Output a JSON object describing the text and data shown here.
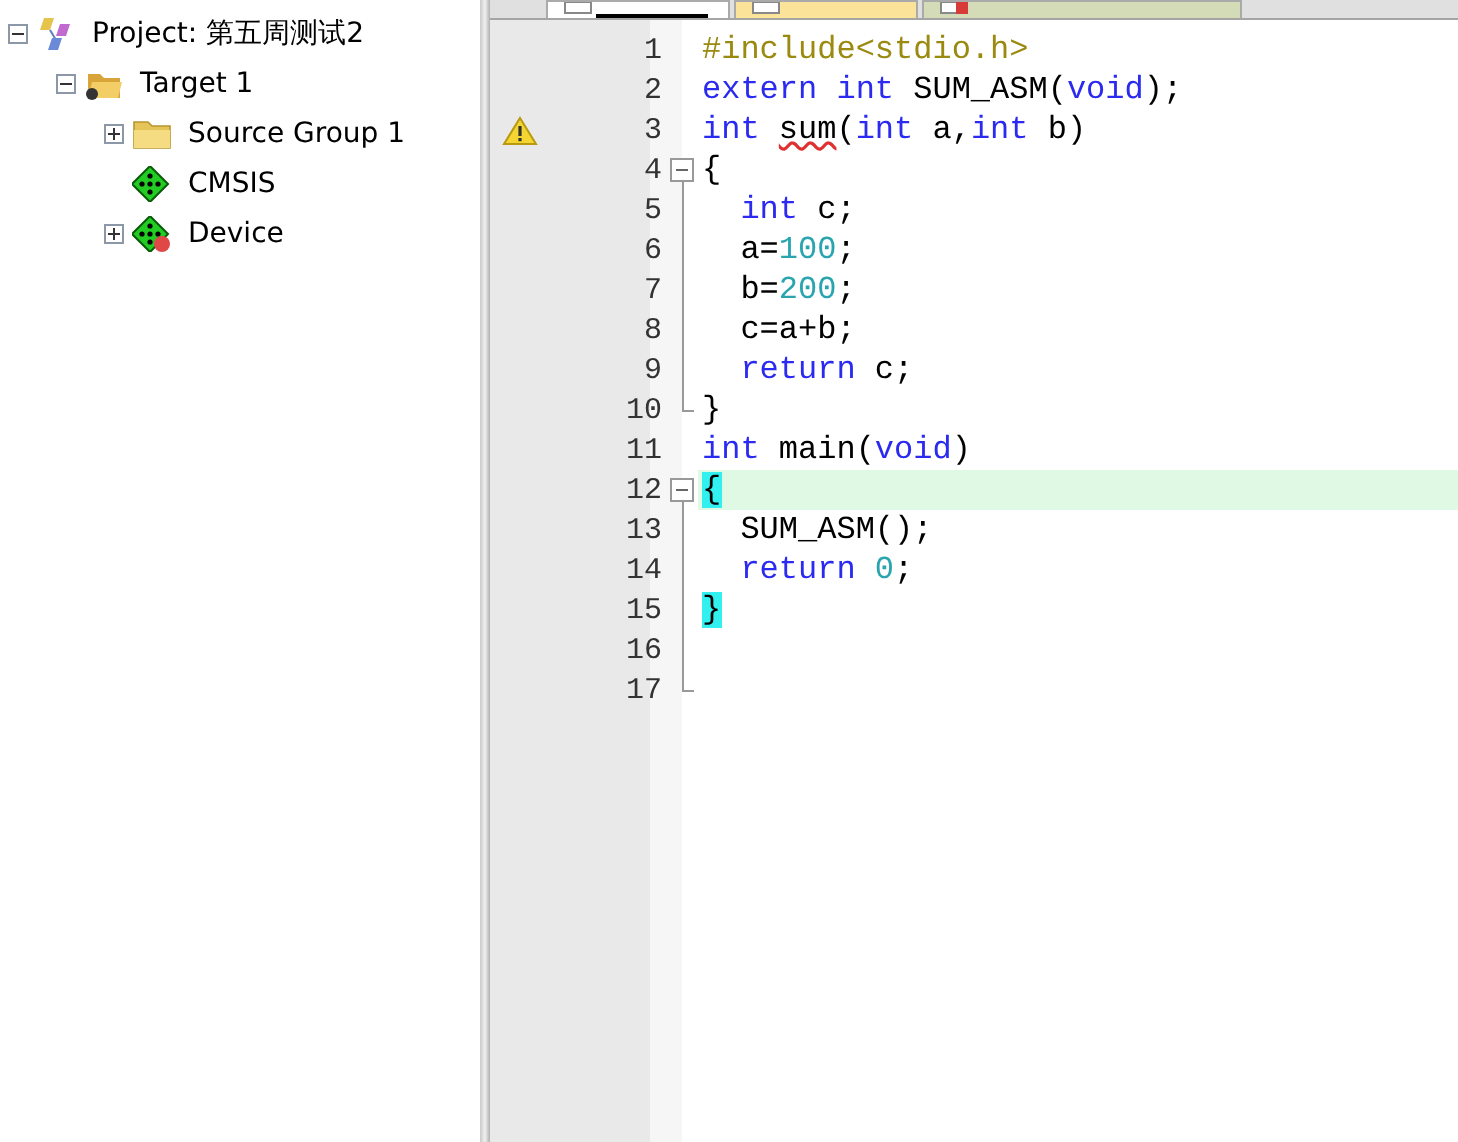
{
  "project_tree": [
    {
      "label": "Project: 第五周测试2",
      "kind": "project",
      "expanded": true,
      "children": [
        {
          "label": "Target 1",
          "kind": "target",
          "expanded": true,
          "children": [
            {
              "label": "Source Group 1",
              "kind": "folder",
              "expanded": false
            },
            {
              "label": "CMSIS",
              "kind": "component"
            },
            {
              "label": "Device",
              "kind": "component-error",
              "expanded": false
            }
          ]
        }
      ]
    }
  ],
  "editor_tabs": [
    {
      "selected": true,
      "color": "#ffffff",
      "kind": "file"
    },
    {
      "selected": false,
      "color": "#fbe39a",
      "kind": "file"
    },
    {
      "selected": false,
      "color": "#d3dcb6",
      "kind": "file-error"
    }
  ],
  "code_lines": [
    {
      "number": "1",
      "kind": "plain",
      "segments": [
        {
          "text": "#include<stdio.h>",
          "kind": "preprocessor"
        }
      ]
    },
    {
      "number": "2",
      "kind": "plain",
      "segments": [
        {
          "text": "extern int",
          "kind": "keyword"
        },
        {
          "text": " SUM_ASM(",
          "kind": "plain"
        },
        {
          "text": "void",
          "kind": "keyword"
        },
        {
          "text": ");",
          "kind": "plain"
        }
      ]
    },
    {
      "number": "3",
      "kind": "plain",
      "warning": true,
      "segments": [
        {
          "text": "int ",
          "kind": "keyword"
        },
        {
          "text": "sum",
          "kind": "error"
        },
        {
          "text": "(",
          "kind": "plain"
        },
        {
          "text": "int",
          "kind": "keyword"
        },
        {
          "text": " a,",
          "kind": "plain"
        },
        {
          "text": "int",
          "kind": "keyword"
        },
        {
          "text": " b)",
          "kind": "plain"
        }
      ]
    },
    {
      "number": "4",
      "kind": "fold-start",
      "segments": [
        {
          "text": "{",
          "kind": "plain"
        }
      ]
    },
    {
      "number": "5",
      "kind": "fold-body",
      "segments": [
        {
          "text": "  int",
          "kind": "keyword"
        },
        {
          "text": " c;",
          "kind": "plain"
        }
      ]
    },
    {
      "number": "6",
      "kind": "fold-body",
      "segments": [
        {
          "text": "  a=",
          "kind": "plain"
        },
        {
          "text": "100",
          "kind": "number"
        },
        {
          "text": ";",
          "kind": "plain"
        }
      ]
    },
    {
      "number": "7",
      "kind": "fold-body",
      "segments": [
        {
          "text": "  b=",
          "kind": "plain"
        },
        {
          "text": "200",
          "kind": "number"
        },
        {
          "text": ";",
          "kind": "plain"
        }
      ]
    },
    {
      "number": "8",
      "kind": "fold-body",
      "segments": [
        {
          "text": "  c=a+b;",
          "kind": "plain"
        }
      ]
    },
    {
      "number": "9",
      "kind": "fold-body",
      "segments": [
        {
          "text": "  return",
          "kind": "keyword"
        },
        {
          "text": " c;",
          "kind": "plain"
        }
      ]
    },
    {
      "number": "10",
      "kind": "fold-end",
      "segments": [
        {
          "text": "}",
          "kind": "plain"
        }
      ]
    },
    {
      "number": "11",
      "kind": "plain",
      "segments": [
        {
          "text": "int",
          "kind": "keyword"
        },
        {
          "text": " main(",
          "kind": "plain"
        },
        {
          "text": "void",
          "kind": "keyword"
        },
        {
          "text": ")",
          "kind": "plain"
        }
      ]
    },
    {
      "number": "12",
      "kind": "fold-start",
      "current": true,
      "segments": [
        {
          "text": "{",
          "kind": "brace-match"
        }
      ]
    },
    {
      "number": "13",
      "kind": "fold-body",
      "segments": [
        {
          "text": "  SUM_ASM();",
          "kind": "plain"
        }
      ]
    },
    {
      "number": "14",
      "kind": "fold-body",
      "segments": [
        {
          "text": "  return ",
          "kind": "keyword"
        },
        {
          "text": "0",
          "kind": "number"
        },
        {
          "text": ";",
          "kind": "plain"
        }
      ]
    },
    {
      "number": "15",
      "kind": "fold-body",
      "segments": [
        {
          "text": "}",
          "kind": "brace-match"
        }
      ]
    },
    {
      "number": "16",
      "kind": "fold-body"
    },
    {
      "number": "17",
      "kind": "fold-end"
    }
  ]
}
